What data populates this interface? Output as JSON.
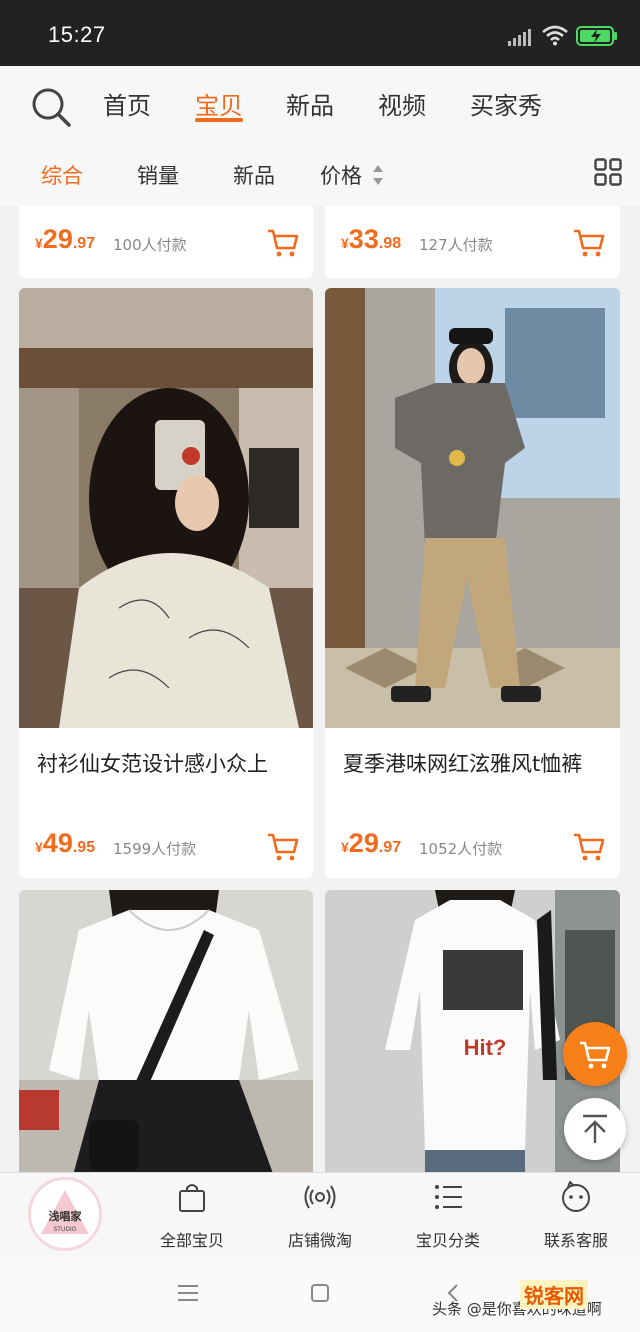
{
  "status_bar": {
    "time": "15:27"
  },
  "nav_tabs": [
    {
      "label": "首页",
      "active": false
    },
    {
      "label": "宝贝",
      "active": true
    },
    {
      "label": "新品",
      "active": false
    },
    {
      "label": "视频",
      "active": false
    },
    {
      "label": "买家秀",
      "active": false
    }
  ],
  "sort_tabs": [
    {
      "label": "综合",
      "active": true
    },
    {
      "label": "销量",
      "active": false
    },
    {
      "label": "新品",
      "active": false
    },
    {
      "label": "价格",
      "active": false
    }
  ],
  "products": [
    {
      "title": "",
      "currency": "¥",
      "price_int": "29",
      "price_dec": ".97",
      "paid": "100人付款"
    },
    {
      "title": "",
      "currency": "¥",
      "price_int": "33",
      "price_dec": ".98",
      "paid": "127人付款"
    },
    {
      "title": "衬衫仙女范设计感小众上",
      "currency": "¥",
      "price_int": "49",
      "price_dec": ".95",
      "paid": "1599人付款"
    },
    {
      "title": "夏季港味网红泫雅风t恤裤",
      "currency": "¥",
      "price_int": "29",
      "price_dec": ".97",
      "paid": "1052人付款"
    }
  ],
  "shop_logo": {
    "name": "浅唱家",
    "sub": "STUDIO"
  },
  "shop_bar": [
    {
      "label": "全部宝贝",
      "icon": "bag-icon"
    },
    {
      "label": "店铺微淘",
      "icon": "broadcast-icon"
    },
    {
      "label": "宝贝分类",
      "icon": "list-icon"
    },
    {
      "label": "联系客服",
      "icon": "chat-face-icon"
    }
  ],
  "watermark": {
    "text": "头条 @是你喜欢的味道啊",
    "brand": "锐客网"
  },
  "colors": {
    "accent": "#f26b1d",
    "fab": "#f77f17"
  }
}
